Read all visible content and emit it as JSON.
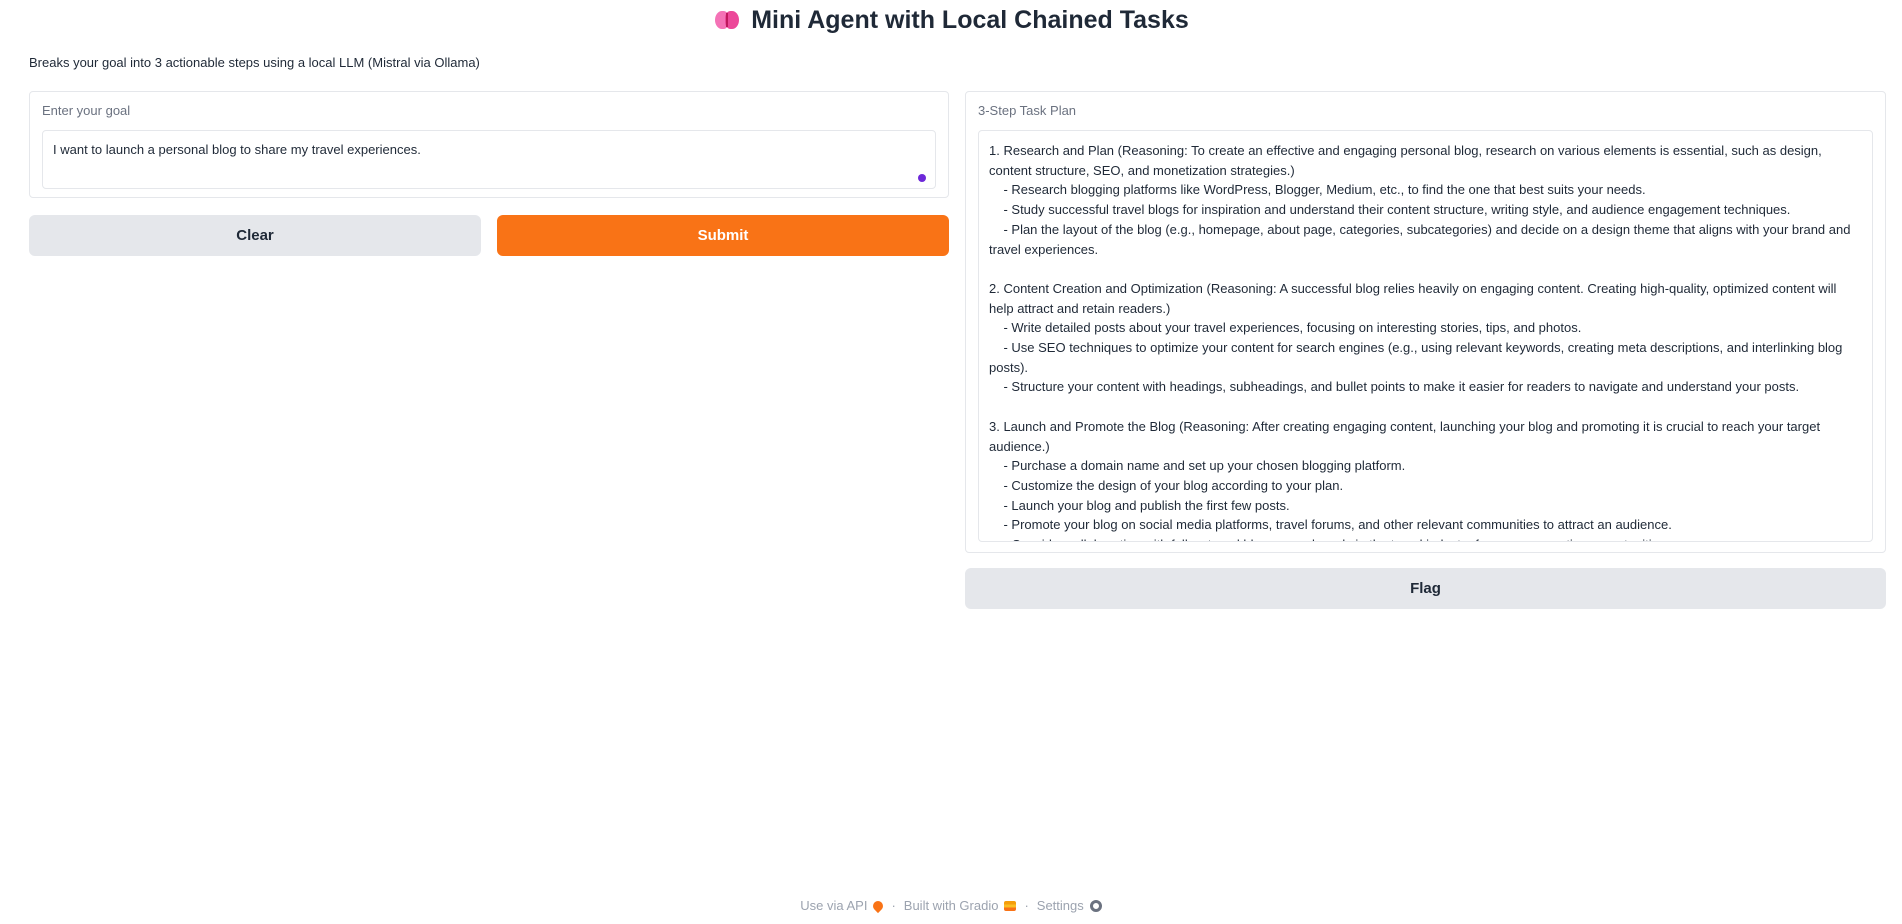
{
  "header": {
    "title": "Mini Agent with Local Chained Tasks",
    "icon": "brain-icon",
    "subtitle": "Breaks your goal into 3 actionable steps using a local LLM (Mistral via Ollama)"
  },
  "goal": {
    "label": "Enter your goal",
    "value": "I want to launch a personal blog to share my travel experiences."
  },
  "buttons": {
    "clear": "Clear",
    "submit": "Submit",
    "flag": "Flag"
  },
  "plan": {
    "label": "3-Step Task Plan",
    "text": "1. Research and Plan (Reasoning: To create an effective and engaging personal blog, research on various elements is essential, such as design, content structure, SEO, and monetization strategies.)\n    - Research blogging platforms like WordPress, Blogger, Medium, etc., to find the one that best suits your needs.\n    - Study successful travel blogs for inspiration and understand their content structure, writing style, and audience engagement techniques.\n    - Plan the layout of the blog (e.g., homepage, about page, categories, subcategories) and decide on a design theme that aligns with your brand and travel experiences.\n\n2. Content Creation and Optimization (Reasoning: A successful blog relies heavily on engaging content. Creating high-quality, optimized content will help attract and retain readers.)\n    - Write detailed posts about your travel experiences, focusing on interesting stories, tips, and photos.\n    - Use SEO techniques to optimize your content for search engines (e.g., using relevant keywords, creating meta descriptions, and interlinking blog posts).\n    - Structure your content with headings, subheadings, and bullet points to make it easier for readers to navigate and understand your posts.\n\n3. Launch and Promote the Blog (Reasoning: After creating engaging content, launching your blog and promoting it is crucial to reach your target audience.)\n    - Purchase a domain name and set up your chosen blogging platform.\n    - Customize the design of your blog according to your plan.\n    - Launch your blog and publish the first few posts.\n    - Promote your blog on social media platforms, travel forums, and other relevant communities to attract an audience.\n    - Consider collaborating with fellow travel bloggers or brands in the travel industry for cross-promotion opportunities."
  },
  "footer": {
    "api": "Use via API",
    "built": "Built with Gradio",
    "settings": "Settings",
    "separator": "·"
  }
}
